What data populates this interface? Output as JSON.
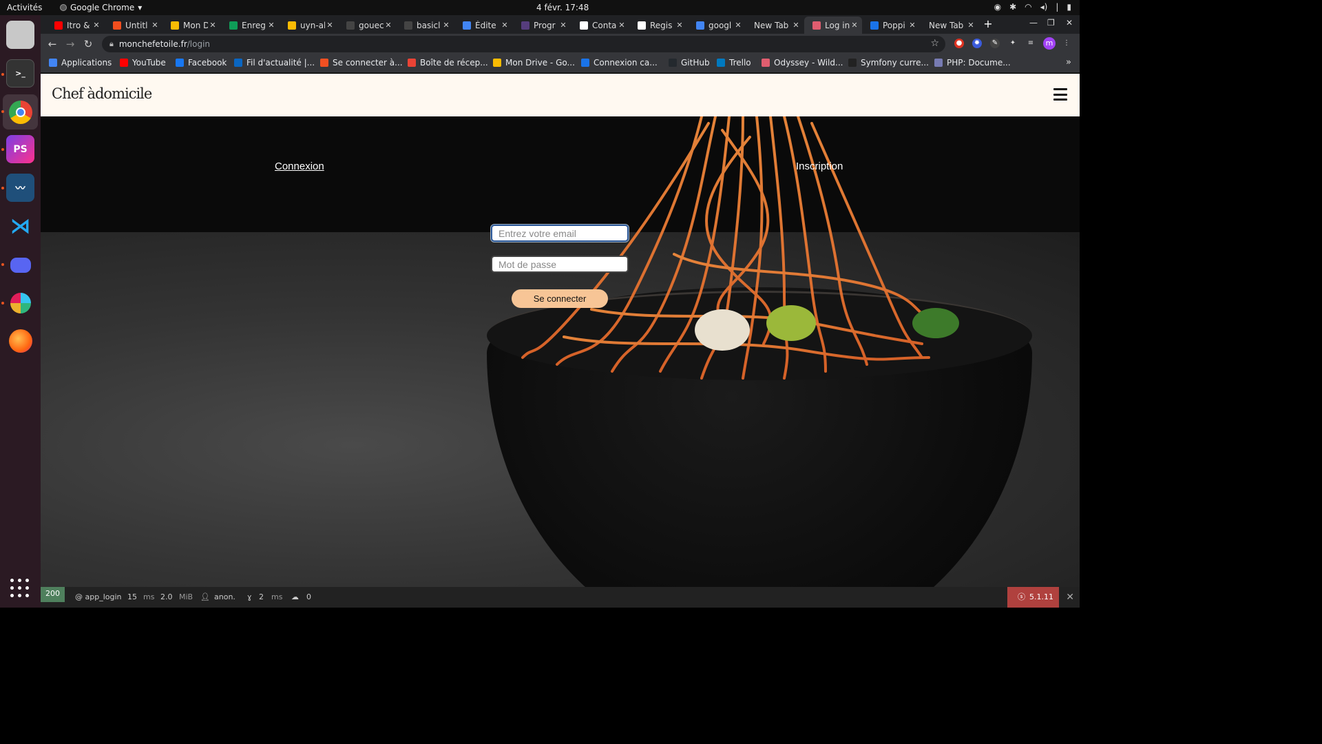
{
  "system": {
    "activities": "Activités",
    "app_name": "Google Chrome",
    "clock": "4 févr.  17:48"
  },
  "tabs": [
    {
      "title": "Itro &",
      "color": "#ff0000"
    },
    {
      "title": "Untitl",
      "color": "#f24e1e"
    },
    {
      "title": "Mon D",
      "color": "#fbbc04"
    },
    {
      "title": "Enreg",
      "color": "#0f9d58"
    },
    {
      "title": "uyn-al",
      "color": "#fbbc04"
    },
    {
      "title": "gouec",
      "color": "#444444"
    },
    {
      "title": "basicl",
      "color": "#444444"
    },
    {
      "title": "Édite",
      "color": "#4285f4"
    },
    {
      "title": "Progr",
      "color": "#563d7c"
    },
    {
      "title": "Conta",
      "color": "#ffffff"
    },
    {
      "title": "Regis",
      "color": "#ffffff"
    },
    {
      "title": "googl",
      "color": "#4285f4"
    },
    {
      "title": "New Tab",
      "color": ""
    },
    {
      "title": "Log in",
      "color": "#e05d6f"
    },
    {
      "title": "Poppi",
      "color": "#1a73e8"
    },
    {
      "title": "New Tab",
      "color": ""
    }
  ],
  "address_bar": {
    "host": "monchefetoile.fr",
    "path": "/login"
  },
  "profile_initial": "m",
  "bookmarks": [
    {
      "label": "Applications",
      "color": "#4285f4"
    },
    {
      "label": "YouTube",
      "color": "#ff0000"
    },
    {
      "label": "Facebook",
      "color": "#1877f2"
    },
    {
      "label": "Fil d'actualité |...",
      "color": "#0a66c2"
    },
    {
      "label": "Se connecter à...",
      "color": "#f25022"
    },
    {
      "label": "Boîte de récep...",
      "color": "#ea4335"
    },
    {
      "label": "Mon Drive - Go...",
      "color": "#fbbc04"
    },
    {
      "label": "Connexion ca...",
      "color": "#1a73e8"
    },
    {
      "label": "GitHub",
      "color": "#24292e"
    },
    {
      "label": "Trello",
      "color": "#0079bf"
    },
    {
      "label": "Odyssey - Wild...",
      "color": "#e05d6f"
    },
    {
      "label": "Symfony curre...",
      "color": "#222222"
    },
    {
      "label": "PHP: Docume...",
      "color": "#777bb3"
    }
  ],
  "site": {
    "logo": "Chef àdomicile",
    "nav_login": "Connexion",
    "nav_register": "Inscription",
    "email_placeholder": "Entrez votre email",
    "password_placeholder": "Mot de passe",
    "submit": "Se connecter"
  },
  "debug_bar": {
    "status": "200",
    "route": "@ app_login",
    "time_value": "15",
    "time_unit": "ms",
    "memory_value": "2.0",
    "memory_unit": "MiB",
    "user": "anon.",
    "twig_value": "2",
    "twig_unit": "ms",
    "cache_value": "0",
    "version": "5.1.11"
  },
  "colors": {
    "accent_button": "#f7c596",
    "header_bg": "#fff9f1",
    "status_ok": "#4f805d",
    "symfony_red": "#b0413e"
  }
}
